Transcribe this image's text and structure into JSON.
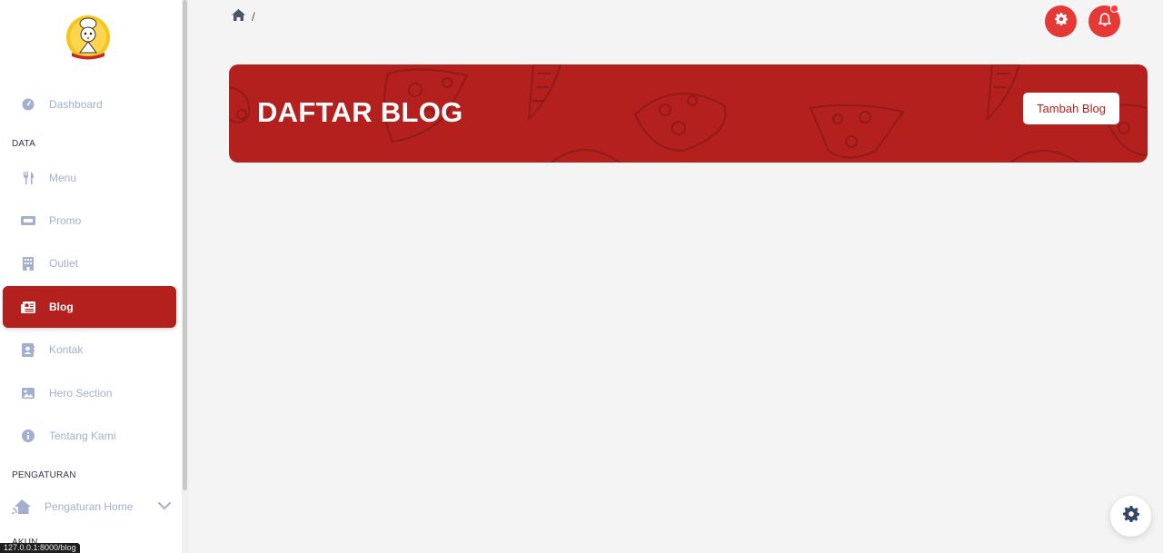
{
  "sidebar": {
    "logo_alt": "logo",
    "items": {
      "dashboard": "Dashboard",
      "menu": "Menu",
      "promo": "Promo",
      "outlet": "Outlet",
      "blog": "Blog",
      "kontak": "Kontak",
      "hero": "Hero Section",
      "tentang": "Tentang Kami"
    },
    "sections": {
      "data": "DATA",
      "pengaturan": "PENGATURAN",
      "akun": "AKUN"
    },
    "group": {
      "pengaturan_home": "Pengaturan Home"
    }
  },
  "breadcrumb": {
    "separator": "/"
  },
  "banner": {
    "title": "DAFTAR BLOG",
    "add_button": "Tambah Blog"
  },
  "status_bar": {
    "url": "127.0.0.1:8000/blog"
  },
  "colors": {
    "brand": "#b3201e",
    "accent": "#e53935",
    "muted_text": "#a3aed0"
  },
  "icons": {
    "home": "home-icon",
    "gear": "gear-icon",
    "bell": "bell-icon"
  }
}
